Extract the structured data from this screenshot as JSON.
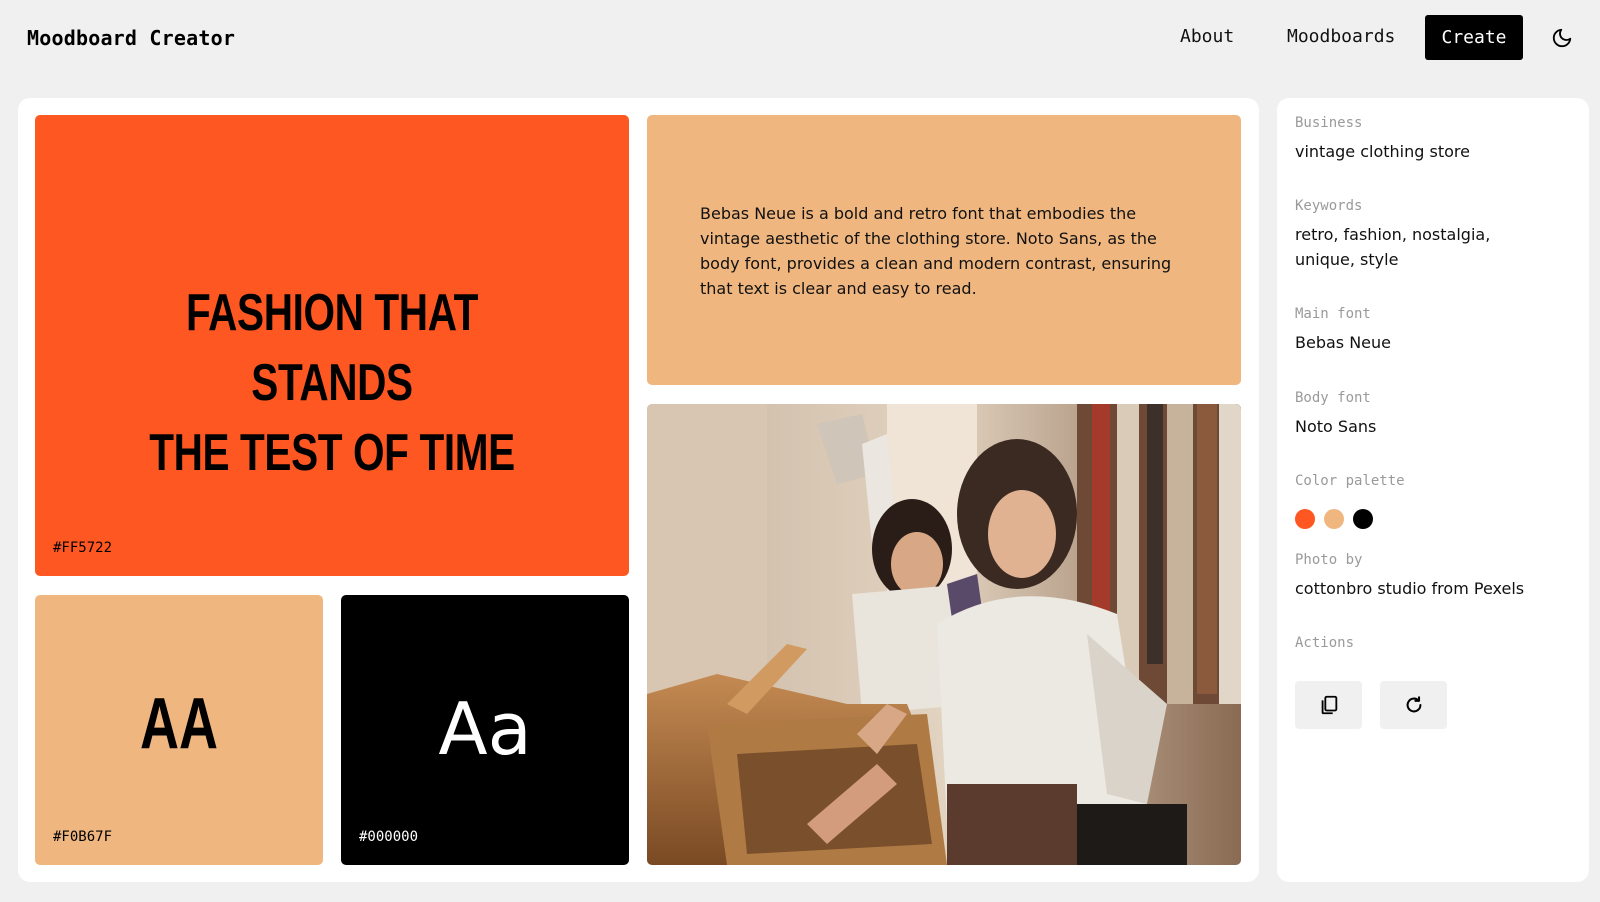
{
  "header": {
    "brand": "Moodboard Creator",
    "nav": {
      "about": "About",
      "moodboards": "Moodboards"
    },
    "create_label": "Create",
    "theme_icon": "moon-icon"
  },
  "board": {
    "headline": {
      "lines": [
        "Fashion that stands",
        "the test of time"
      ],
      "bg": "#FF5722",
      "hex": "#FF5722"
    },
    "description": {
      "text": "Bebas Neue is a bold and retro font that embodies the vintage aesthetic of the clothing store. Noto Sans, as the body font, provides a clean and modern contrast, ensuring that text is clear and easy to read.",
      "bg": "#F0B67F"
    },
    "main_font_sample": {
      "text": "AA",
      "bg": "#F0B67F",
      "hex": "#F0B67F"
    },
    "body_font_sample": {
      "text": "Aa",
      "bg": "#000000",
      "hex": "#000000"
    }
  },
  "sidebar": {
    "business": {
      "label": "Business",
      "value": "vintage clothing store"
    },
    "keywords": {
      "label": "Keywords",
      "value": "retro, fashion, nostalgia, unique, style"
    },
    "main_font": {
      "label": "Main font",
      "value": "Bebas Neue"
    },
    "body_font": {
      "label": "Body font",
      "value": "Noto Sans"
    },
    "palette": {
      "label": "Color palette",
      "colors": [
        "#FF5722",
        "#F0B67F",
        "#000000"
      ]
    },
    "photo": {
      "label": "Photo by",
      "value": "cottonbro studio from Pexels"
    },
    "actions": {
      "label": "Actions",
      "icons": [
        "copy-icon",
        "refresh-icon"
      ]
    }
  }
}
